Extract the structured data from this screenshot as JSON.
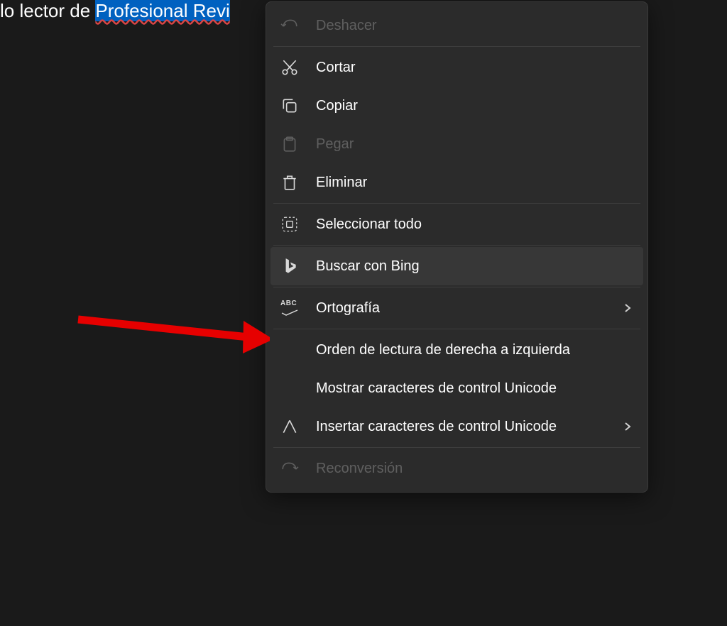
{
  "editor": {
    "text_before_selection": "lo lector de ",
    "selected_text": "Profesional Revi"
  },
  "context_menu": {
    "items": [
      {
        "label": "Deshacer",
        "icon": "undo-icon",
        "disabled": true,
        "divider_after": true
      },
      {
        "label": "Cortar",
        "icon": "cut-icon"
      },
      {
        "label": "Copiar",
        "icon": "copy-icon"
      },
      {
        "label": "Pegar",
        "icon": "paste-icon",
        "disabled": true
      },
      {
        "label": "Eliminar",
        "icon": "delete-icon",
        "divider_after": true
      },
      {
        "label": "Seleccionar todo",
        "icon": "select-all-icon",
        "divider_after": true
      },
      {
        "label": "Buscar con Bing",
        "icon": "bing-icon",
        "highlighted": true,
        "divider_after": true
      },
      {
        "label": "Ortografía",
        "icon": "abc-icon",
        "has_chevron": true,
        "divider_after": true
      },
      {
        "label": "Orden de lectura de derecha a izquierda",
        "icon": null
      },
      {
        "label": "Mostrar caracteres de control Unicode",
        "icon": null
      },
      {
        "label": "Insertar caracteres de control Unicode",
        "icon": "insert-icon",
        "has_chevron": true,
        "divider_after": true
      },
      {
        "label": "Reconversión",
        "icon": "redo-icon",
        "disabled": true
      }
    ]
  },
  "annotation": {
    "arrow_color": "#e60000"
  }
}
